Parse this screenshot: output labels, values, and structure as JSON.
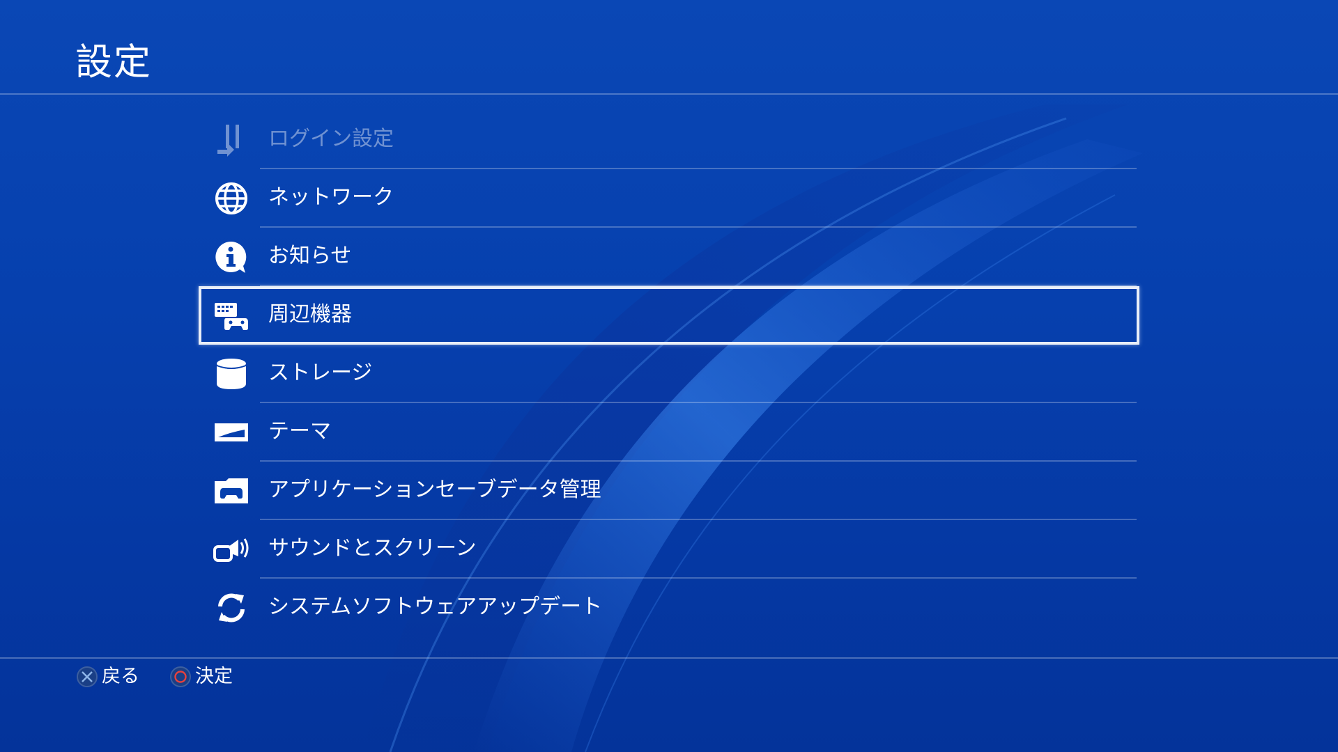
{
  "page": {
    "title": "設定"
  },
  "menu": {
    "items": [
      {
        "label": "ログイン設定",
        "icon": "login-icon",
        "state": "dimmed"
      },
      {
        "label": "ネットワーク",
        "icon": "globe-icon",
        "state": "normal"
      },
      {
        "label": "お知らせ",
        "icon": "info-icon",
        "state": "normal"
      },
      {
        "label": "周辺機器",
        "icon": "devices-icon",
        "state": "selected"
      },
      {
        "label": "ストレージ",
        "icon": "storage-icon",
        "state": "normal"
      },
      {
        "label": "テーマ",
        "icon": "theme-icon",
        "state": "normal"
      },
      {
        "label": "アプリケーションセーブデータ管理",
        "icon": "savedata-folder-icon",
        "state": "normal"
      },
      {
        "label": "サウンドとスクリーン",
        "icon": "sound-screen-icon",
        "state": "normal"
      },
      {
        "label": "システムソフトウェアアップデート",
        "icon": "update-icon",
        "state": "normal"
      }
    ]
  },
  "hints": {
    "back": {
      "label": "戻る",
      "icon": "cross-button-icon"
    },
    "confirm": {
      "label": "決定",
      "icon": "circle-button-icon"
    }
  },
  "colors": {
    "background": "#0640ae",
    "selection_border": "#e8eef8",
    "circle_button": "#e8413c",
    "cross_button": "#8fb6ea"
  }
}
